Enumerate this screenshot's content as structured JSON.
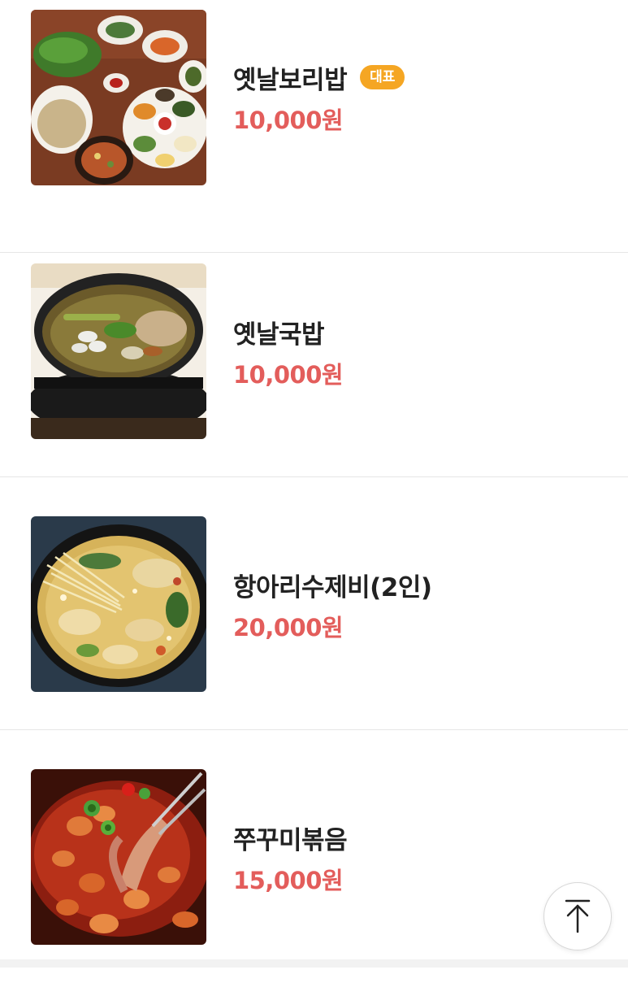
{
  "menu": {
    "items": [
      {
        "name": "옛날보리밥",
        "price": "10,000원",
        "badge": "대표",
        "image_icon": "barley-rice-table-photo"
      },
      {
        "name": "옛날국밥",
        "price": "10,000원",
        "image_icon": "gukbap-stone-pot-photo"
      },
      {
        "name": "항아리수제비(2인)",
        "price": "20,000원",
        "image_icon": "sujebi-pot-photo"
      },
      {
        "name": "쭈꾸미볶음",
        "price": "15,000원",
        "image_icon": "stir-fried-webfoot-octopus-photo"
      }
    ]
  },
  "scroll_top": {
    "icon": "arrow-up-to-top-icon"
  },
  "colors": {
    "price": "#e35d5b",
    "badge": "#f5a623",
    "name": "#222222",
    "divider": "#e6e6e6"
  }
}
